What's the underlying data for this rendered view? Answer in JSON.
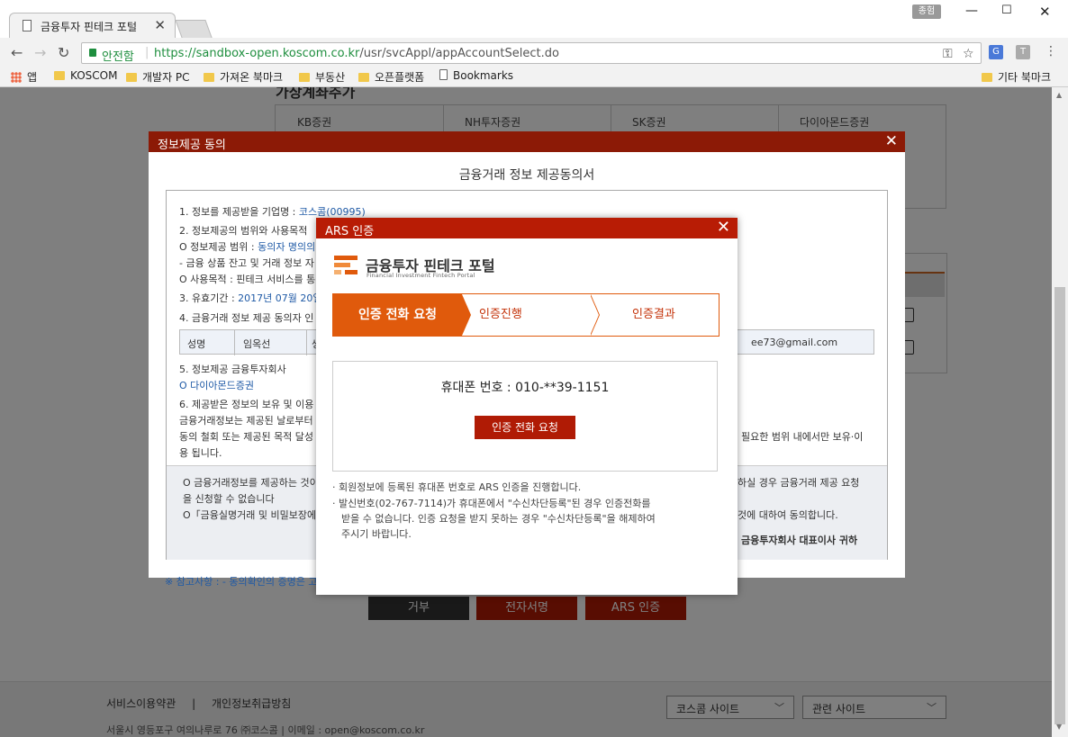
{
  "browser": {
    "tab_title": "금융투자 핀테크 포털",
    "user_badge": "종험",
    "secure_label": "안전함",
    "url_scheme_host": "https://sandbox-open.koscom.co.kr",
    "url_path": "/usr/svcAppl/appAccountSelect.do",
    "bookmarks": [
      "앱",
      "KOSCOM",
      "개발자 PC",
      "가져온 북마크",
      "부동산",
      "오픈플랫폼",
      "Bookmarks"
    ],
    "other_bookmarks": "기타 북마크"
  },
  "background": {
    "section_title": "가상계좌추가",
    "firms": [
      "KB증권",
      "NH투자증권",
      "SK증권",
      "다이아몬드증권"
    ],
    "buttons": {
      "reject": "거부",
      "esign": "전자서명",
      "ars": "ARS 인증"
    },
    "footer": {
      "terms": "서비스이용약관",
      "divider": "|",
      "privacy": "개인정보취급방침",
      "address": "서울시 영등포구 여의나루로 76 ㈜코스콤 | 이메일 : open@koscom.co.kr",
      "koscom_sites": "코스콤 사이트",
      "related_sites": "관련 사이트"
    }
  },
  "consent": {
    "header": "정보제공 동의",
    "title": "금융거래 정보 제공동의서",
    "line1_label": "1. 정보를 제공받을 기업명 : ",
    "line1_value": "코스콤(00995)",
    "line2": "2. 정보제공의 범위와 사용목적",
    "line3_label": "O 정보제공 범위 : ",
    "line3_value": "동의자 명의의",
    "line4": "- 금융 상품 잔고 및 거래 정보 자",
    "line5": "O 사용목적 : 핀테크 서비스를 통",
    "line6_label": "3. 유효기간 : ",
    "line6_value": "2017년 07월 20일",
    "line7": "4. 금융거래 정보 제공 동의자 인",
    "table_name_label": "성명",
    "table_name_value": "임옥선",
    "table_col3": "생",
    "table_email": "ee73@gmail.com",
    "line8": "5. 정보제공 금융투자회사",
    "line9": "O 다이아몬드증권",
    "line10": "6. 제공받은 정보의 보유 및 이용",
    "line11": "금융거래정보는 제공된 날로부터",
    "line12": "동의 철회 또는 제공된 목적 달성",
    "line12_right": "필요한 범위 내에서만 보유·이",
    "line13": "용 됩니다.",
    "lower1": "O 금융거래정보를 제공하는 것이",
    "lower1_right": "하실 경우 금융거래 제공 요청",
    "lower2": "을 신청할 수 없습니다",
    "lower3": "O「금융실명거래 및 비밀보장에",
    "lower3_right": "것에 대하여 동의합니다.",
    "lower4_right": "금융투자회사 대표이사 귀하",
    "reference": "※ 참고사항 : - 동의확인의 증명은 고"
  },
  "ars": {
    "header": "ARS 인증",
    "brand": "금융투자 핀테크 포털",
    "brand_sub": "Financial Investment Fintech Portal",
    "steps": [
      "인증 전화 요청",
      "인증진행",
      "인증결과"
    ],
    "phone_label": "휴대폰 번호 : 010-**39-1151",
    "request_button": "인증 전화 요청",
    "notes": [
      "· 회원정보에 등록된 휴대폰 번호로 ARS 인증을 진행합니다.",
      "· 발신번호(02-767-7114)가 휴대폰에서 \"수신차단등록\"된 경우 인증전화를",
      "받을 수 없습니다. 인증 요청을 받지 못하는 경우 \"수신차단등록\"을 해제하여",
      "주시기 바랍니다."
    ]
  },
  "colors": {
    "modal_header": "#8c1a06",
    "ars_header": "#b81c05",
    "accent": "#e05a0c"
  }
}
